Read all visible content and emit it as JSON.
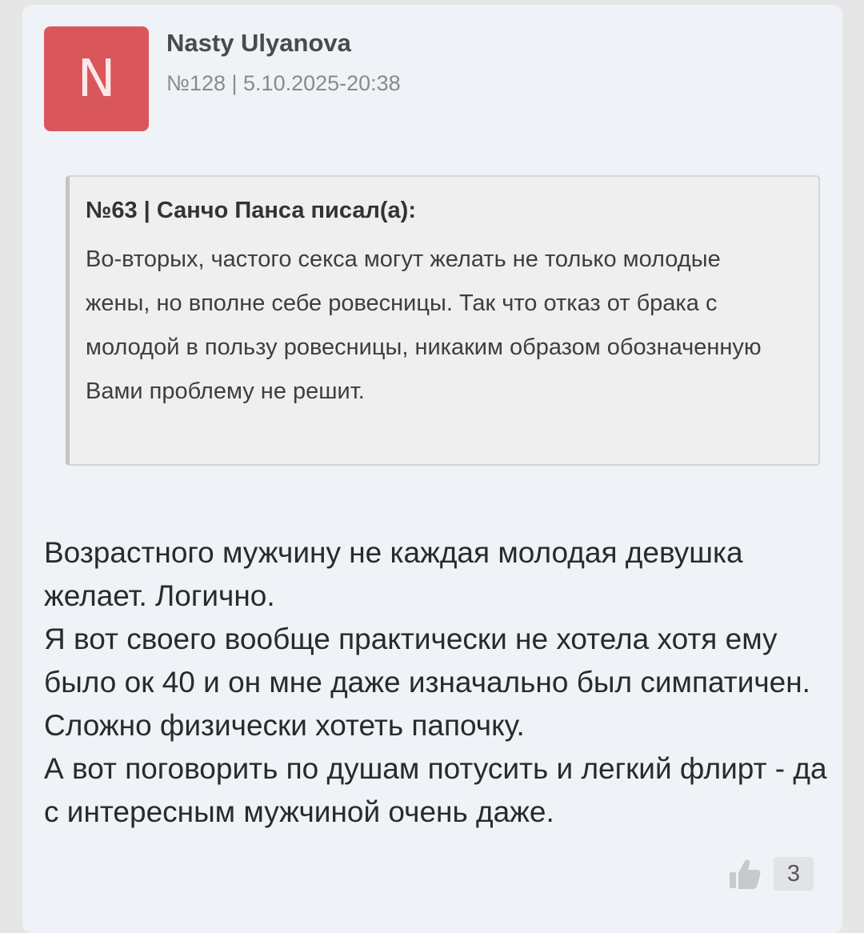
{
  "post": {
    "avatar_letter": "N",
    "avatar_color": "#d9575b",
    "author": "Nasty Ulyanova",
    "meta": "№128 | 5.10.2025-20:38",
    "quote": {
      "header": "№63 | Санчо Панса писал(а):",
      "text": "Во-вторых, частого секса могут желать не только молодые жены, но вполне себе ровесницы. Так что отказ от брака с молодой в пользу ровесницы, никаким образом обозначенную Вами проблему не решит."
    },
    "body_lines": [
      "Возрастного мужчину не каждая молодая девушка желает. Логично.",
      "Я вот своего вообще практически не хотела хотя ему было ок 40 и он мне даже изначально был симпатичен. Сложно физически хотеть папочку.",
      "А вот поговорить по душам потусить и легкий флирт - да с интересным мужчиной очень даже."
    ],
    "like_icon": "thumbs-up-icon",
    "like_count": "3"
  }
}
